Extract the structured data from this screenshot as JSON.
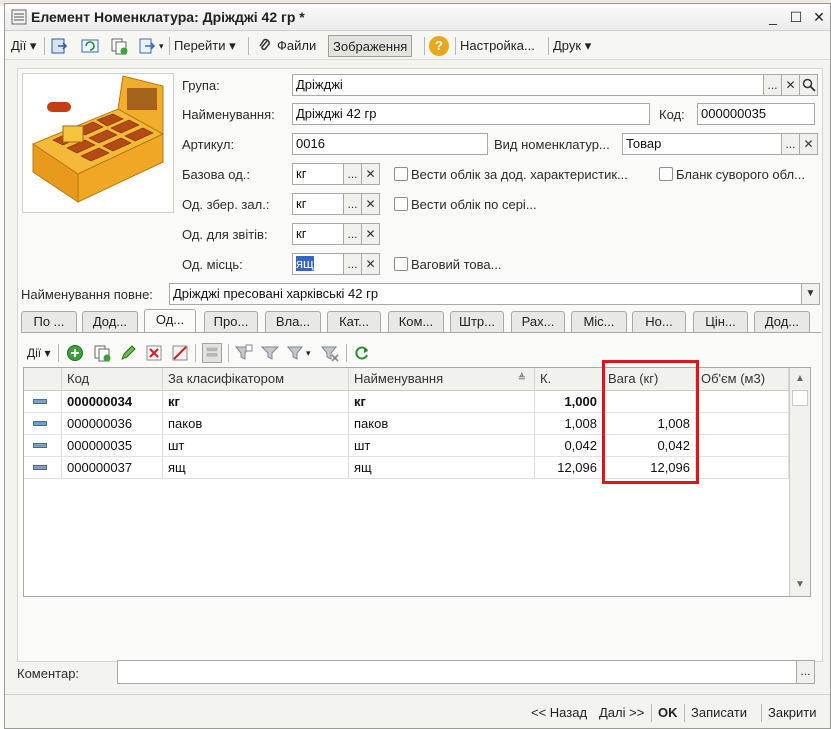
{
  "window": {
    "title": "Елемент Номенклатура: Дріжджі 42 гр *",
    "min_glyph": "_",
    "max_glyph": "☐",
    "close_glyph": "✕"
  },
  "toolbar": {
    "actions_label": "Дії",
    "goto_label": "Перейти",
    "files_label": "Файли",
    "image_label": "Зображення",
    "help_glyph": "?",
    "settings_label": "Настройка...",
    "print_label": "Друк"
  },
  "form": {
    "group_label": "Група:",
    "group_value": "Дріжджі",
    "name_label": "Найменування:",
    "name_value": "Дріжджі 42 гр",
    "code_label": "Код:",
    "code_value": "000000035",
    "article_label": "Артикул:",
    "article_value": "0016",
    "kind_label": "Вид номенклатур...",
    "kind_value": "Товар",
    "base_unit_label": "Базова од.:",
    "base_unit_value": "кг",
    "extra_char_label": "Вести облік за дод. характеристик...",
    "strict_form_label": "Бланк суворого обл...",
    "storage_unit_label": "Од. збер. зал.:",
    "storage_unit_value": "кг",
    "series_label": "Вести облік по сері...",
    "report_unit_label": "Од. для звітів:",
    "report_unit_value": "кг",
    "places_unit_label": "Од. місць:",
    "places_unit_value": "ящ",
    "weight_item_label": "Ваговий това...",
    "fullname_label": "Найменування повне:",
    "fullname_value": "Дріжджі пресовані харківські 42 гр",
    "comment_label": "Коментар:",
    "comment_value": "",
    "dots": "...",
    "clear_glyph": "✕",
    "search_glyph": "🔍",
    "dropdown_glyph": "▼"
  },
  "tabs": [
    "По ...",
    "Дод...",
    "Од...",
    "Про...",
    "Вла...",
    "Кат...",
    "Ком...",
    "Штр...",
    "Рах...",
    "Міс...",
    "Но...",
    "Цін...",
    "Дод..."
  ],
  "grid_toolbar": {
    "actions_label": "Дії"
  },
  "table": {
    "columns": [
      "Код",
      "За класифікатором",
      "Найменування",
      "К.",
      "Вага (кг)",
      "Об'єм (м3)"
    ],
    "rows": [
      {
        "code": "000000034",
        "classifier": "кг",
        "name": "кг",
        "k": "1,000",
        "weight": "",
        "volume": "",
        "bold": true
      },
      {
        "code": "000000036",
        "classifier": "паков",
        "name": "паков",
        "k": "1,008",
        "weight": "1,008",
        "volume": ""
      },
      {
        "code": "000000035",
        "classifier": "шт",
        "name": "шт",
        "k": "0,042",
        "weight": "0,042",
        "volume": ""
      },
      {
        "code": "000000037",
        "classifier": "ящ",
        "name": "ящ",
        "k": "12,096",
        "weight": "12,096",
        "volume": ""
      }
    ]
  },
  "footer": {
    "back_label": "<< Назад",
    "next_label": "Далі >>",
    "ok_label": "OK",
    "write_label": "Записати",
    "close_label": "Закрити"
  },
  "colors": {
    "highlight": "#e0141a",
    "selection": "#3567c2"
  }
}
